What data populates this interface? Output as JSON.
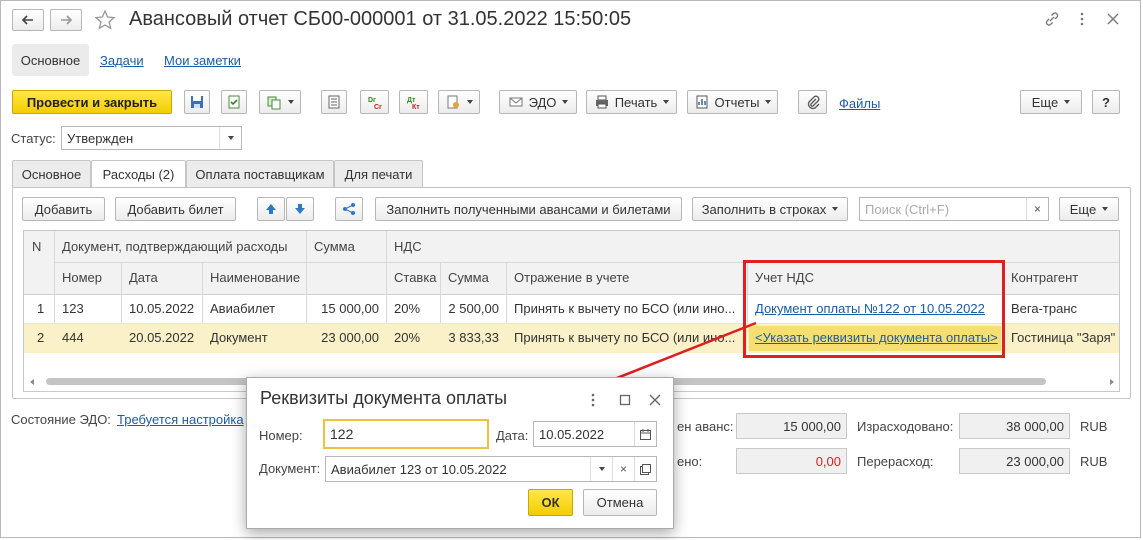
{
  "window": {
    "title": "Авансовый отчет СБ00-000001 от 31.05.2022 15:50:05"
  },
  "nav": {
    "tabs": [
      "Основное",
      "Задачи",
      "Мои заметки"
    ]
  },
  "toolbar": {
    "post_close": "Провести и закрыть",
    "edo": "ЭДО",
    "print": "Печать",
    "reports": "Отчеты",
    "files": "Файлы",
    "more": "Еще",
    "help": "?"
  },
  "status": {
    "label": "Статус:",
    "value": "Утвержден"
  },
  "tabs": [
    "Основное",
    "Расходы (2)",
    "Оплата поставщикам",
    "Для печати"
  ],
  "table_toolbar": {
    "add": "Добавить",
    "add_ticket": "Добавить билет",
    "fill_advances": "Заполнить полученными авансами и билетами",
    "fill_rows": "Заполнить в строках",
    "search_placeholder": "Поиск (Ctrl+F)",
    "more": "Еще"
  },
  "table": {
    "headers": {
      "n": "N",
      "doc": "Документ, подтверждающий расходы",
      "number": "Номер",
      "date": "Дата",
      "name": "Наименование",
      "sum": "Сумма",
      "vat": "НДС",
      "rate": "Ставка",
      "vat_sum": "Сумма",
      "reflection": "Отражение в учете",
      "vat_account": "Учет НДС",
      "counterparty": "Контрагент"
    },
    "rows": [
      {
        "n": "1",
        "number": "123",
        "date": "10.05.2022",
        "name": "Авиабилет",
        "sum": "15 000,00",
        "rate": "20%",
        "vat_sum": "2 500,00",
        "reflection": "Принять к вычету по БСО (или ино...",
        "vat_account": "Документ оплаты №122 от 10.05.2022",
        "counterparty": "Вега-транс"
      },
      {
        "n": "2",
        "number": "444",
        "date": "20.05.2022",
        "name": "Документ",
        "sum": "23 000,00",
        "rate": "20%",
        "vat_sum": "3 833,33",
        "reflection": "Принять к вычету по БСО (или ино...",
        "vat_account": "<Указать реквизиты документа оплаты>",
        "counterparty": "Гостиница \"Заря\""
      }
    ]
  },
  "footer": {
    "edo_label": "Состояние ЭДО:",
    "edo_link": "Требуется настройка",
    "advance_label": "ен аванс:",
    "advance": "15 000,00",
    "spent_label": "Израсходовано:",
    "spent": "38 000,00",
    "spent_cur": "RUB",
    "rest_label": "ено:",
    "rest": "0,00",
    "overspent_label": "Перерасход:",
    "overspent": "23 000,00",
    "overspent_cur": "RUB"
  },
  "dialog": {
    "title": "Реквизиты документа оплаты",
    "number_label": "Номер:",
    "number": "122",
    "date_label": "Дата:",
    "date": "10.05.2022",
    "doc_label": "Документ:",
    "doc": "Авиабилет 123 от 10.05.2022",
    "ok": "ОК",
    "cancel": "Отмена"
  },
  "colors": {
    "accent_yellow": "#f5d000",
    "highlight_red": "#e02020",
    "link_blue": "#1c5ba8",
    "selected_row": "#fbf1c8"
  }
}
